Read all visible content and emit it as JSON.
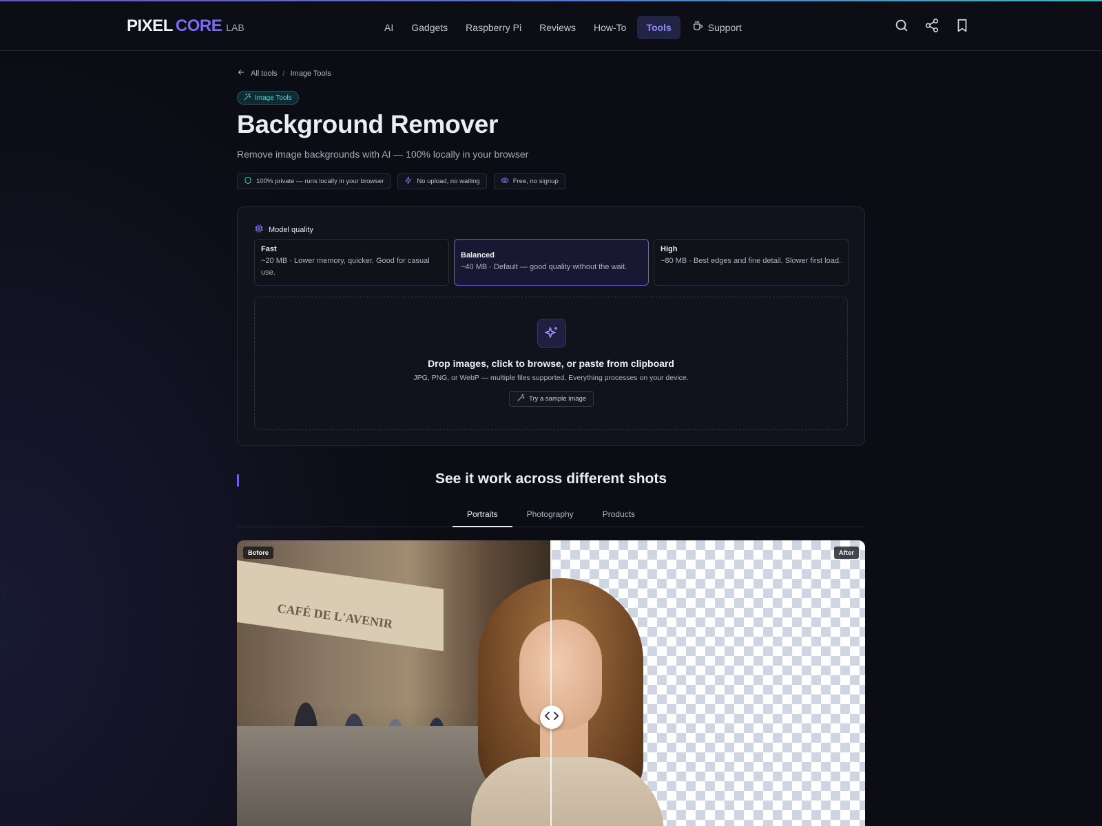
{
  "brand": {
    "part1": "PIXEL",
    "part2": "CORE",
    "part3": "LAB"
  },
  "nav": {
    "items": [
      "AI",
      "Gadgets",
      "Raspberry Pi",
      "Reviews",
      "How-To",
      "Tools",
      "Support"
    ],
    "active": "Tools"
  },
  "header_icons": [
    "search-icon",
    "share-icon",
    "bookmark-icon"
  ],
  "breadcrumb": {
    "back_label": "All tools",
    "current": "Image Tools"
  },
  "category_tag": "Image Tools",
  "title": "Background Remover",
  "subtitle": "Remove image backgrounds with AI — 100% locally in your browser",
  "badges": [
    {
      "icon": "shield-icon",
      "label": "100% private — runs locally in your browser"
    },
    {
      "icon": "bolt-icon",
      "label": "No upload, no waiting"
    },
    {
      "icon": "eye-icon",
      "label": "Free, no signup"
    }
  ],
  "model_quality": {
    "label": "Model quality",
    "options": [
      {
        "title": "Fast",
        "desc": "~20 MB · Lower memory, quicker. Good for casual use.",
        "selected": false
      },
      {
        "title": "Balanced",
        "desc": "~40 MB · Default — good quality without the wait.",
        "selected": true
      },
      {
        "title": "High",
        "desc": "~80 MB · Best edges and fine detail. Slower first load.",
        "selected": false
      }
    ]
  },
  "dropzone": {
    "title": "Drop images, click to browse, or paste from clipboard",
    "subtitle": "JPG, PNG, or WebP — multiple files supported. Everything processes on your device.",
    "sample_button": "Try a sample image"
  },
  "examples": {
    "heading": "See it work across different shots",
    "tabs": [
      "Portraits",
      "Photography",
      "Products"
    ],
    "active_tab": "Portraits",
    "before_label": "Before",
    "after_label": "After",
    "photo_sign_text": "CAFÉ DE L'AVENIR",
    "slider_position": 0.5
  },
  "colors": {
    "accent": "#7c6cf2",
    "teal": "#22c3c6",
    "background": "#0c0c14"
  }
}
